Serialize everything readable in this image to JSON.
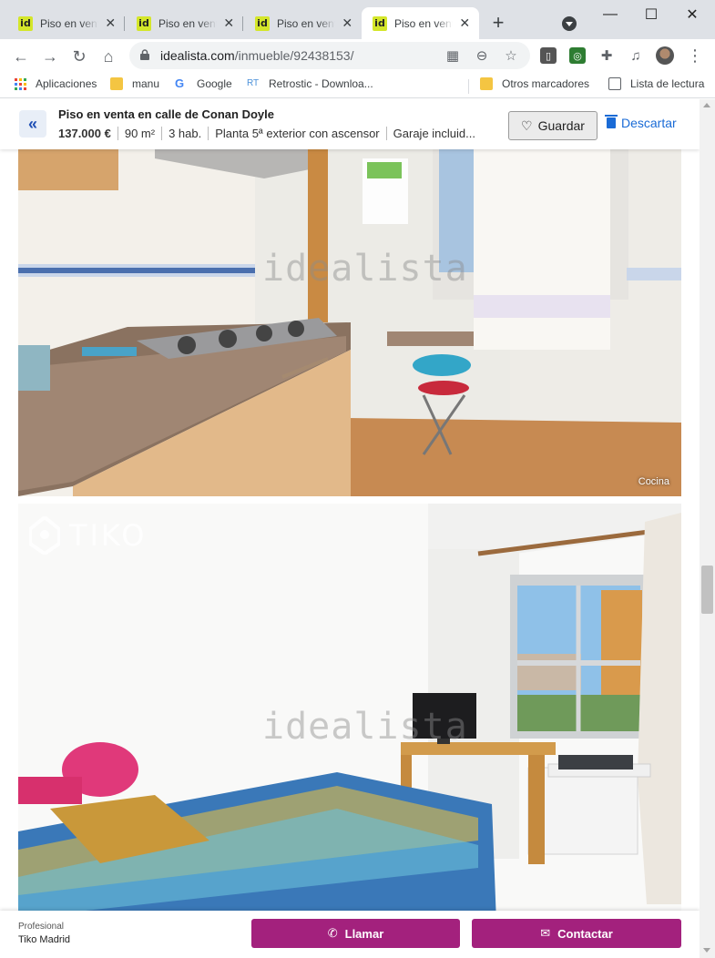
{
  "browser": {
    "tabs": [
      {
        "favicon": "id",
        "title": "Piso en venta en calle de Conan Doyle",
        "active": false
      },
      {
        "favicon": "id",
        "title": "Piso en venta en calle de Conan Doyle",
        "active": false
      },
      {
        "favicon": "id",
        "title": "Piso en venta en calle de Conan Doyle",
        "active": false
      },
      {
        "favicon": "id",
        "title": "Piso en venta en calle de Conan Doyle",
        "active": true
      }
    ],
    "url_host": "idealista.com",
    "url_path": "/inmueble/92438153/",
    "bookmarks": [
      {
        "label": "Aplicaciones",
        "icon": "apps-grid-icon"
      },
      {
        "label": "manu",
        "icon": "folder-icon"
      },
      {
        "label": "Google",
        "icon": "google-icon"
      },
      {
        "label": "Retrostic - Downloa...",
        "icon": "retrostic-icon"
      },
      {
        "label": "Otros marcadores",
        "icon": "folder-icon"
      },
      {
        "label": "Lista de lectura",
        "icon": "reading-list-icon"
      }
    ]
  },
  "listing": {
    "title": "Piso en venta en calle de Conan Doyle",
    "price": "137.000 €",
    "area": "90 m²",
    "rooms": "3 hab.",
    "floor": "Planta 5ª exterior con ascensor",
    "garage": "Garaje incluid..."
  },
  "actions": {
    "save_label": "Guardar",
    "discard_label": "Descartar",
    "call_label": "Llamar",
    "contact_label": "Contactar"
  },
  "photos": [
    {
      "caption": "Cocina",
      "watermark": "idealista"
    },
    {
      "caption": "",
      "watermark": "idealista",
      "brand": "TIKO"
    }
  ],
  "advertiser": {
    "type": "Profesional",
    "name": "Tiko Madrid"
  },
  "colors": {
    "accent": "#a3217d",
    "link_blue": "#1a6bd6",
    "favicon_bg": "#d4e62a"
  }
}
